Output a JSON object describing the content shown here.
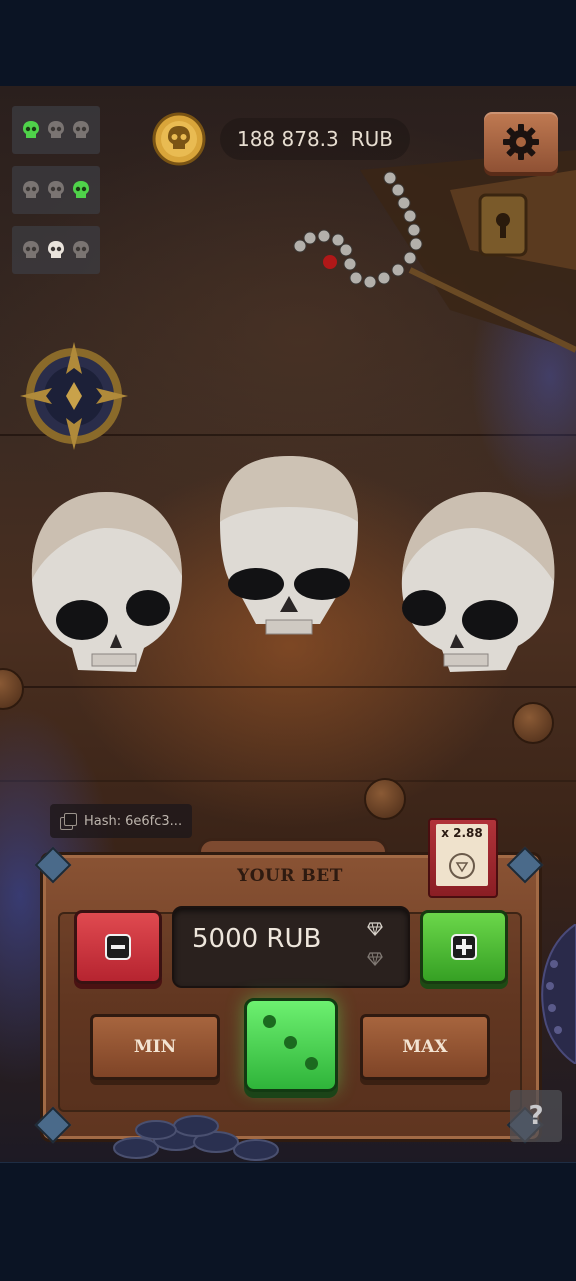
{
  "history": {
    "rows": [
      {
        "skulls": [
          "green",
          "gray",
          "gray"
        ]
      },
      {
        "skulls": [
          "gray",
          "gray",
          "green"
        ]
      },
      {
        "skulls": [
          "gray",
          "white",
          "gray"
        ]
      }
    ]
  },
  "balance": {
    "amount": "188 878.3",
    "currency": "RUB"
  },
  "hash": {
    "label": "Hash:",
    "value": "6e6fc3..."
  },
  "bet": {
    "title": "YOUR BET",
    "value": "5000 RUB",
    "min_label": "MIN",
    "max_label": "MAX",
    "multiplier": "x 2.88"
  },
  "help": {
    "label": "?"
  },
  "colors": {
    "accent_green": "#4fd24a",
    "accent_red": "#d63a42",
    "wood": "#7f4427",
    "background": "#0b1424"
  },
  "icons": [
    "settings-gear-icon",
    "coin-skull-icon",
    "copy-icon",
    "gem-icon",
    "dice-icon",
    "minus-icon",
    "plus-icon",
    "question-icon"
  ]
}
